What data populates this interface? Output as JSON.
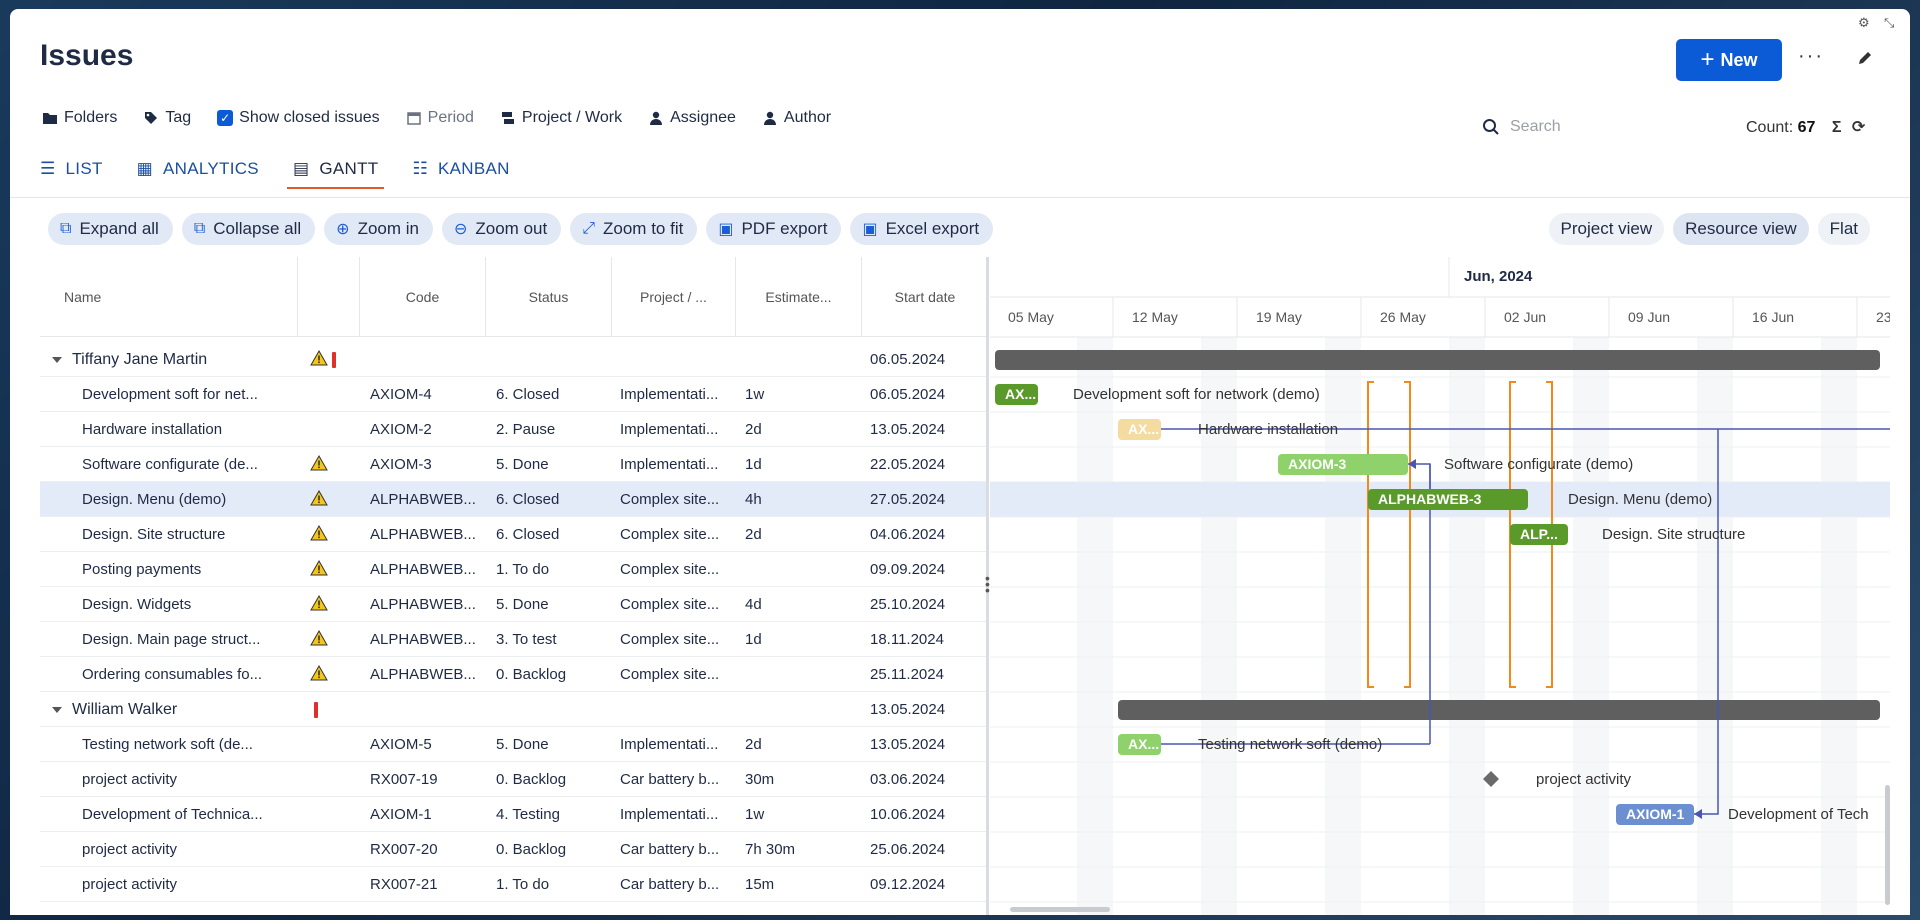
{
  "header": {
    "title": "Issues",
    "new_label": "New",
    "more_icon": "more-horizontal-icon",
    "edit_icon": "pencil-icon"
  },
  "filters": [
    {
      "label": "Folders",
      "icon": "folder-icon"
    },
    {
      "label": "Tag",
      "icon": "tag-icon"
    },
    {
      "label": "Show closed issues",
      "icon": "checkbox-checked-icon"
    },
    {
      "label": "Period",
      "icon": "calendar-icon"
    },
    {
      "label": "Project / Work",
      "icon": "project-icon"
    },
    {
      "label": "Assignee",
      "icon": "user-icon"
    },
    {
      "label": "Author",
      "icon": "user-icon"
    }
  ],
  "search": {
    "placeholder": "Search"
  },
  "count": {
    "label": "Count:",
    "value": "67"
  },
  "tabs": [
    {
      "label": "LIST"
    },
    {
      "label": "ANALYTICS"
    },
    {
      "label": "GANTT"
    },
    {
      "label": "KANBAN"
    }
  ],
  "toolbar": [
    "Expand all",
    "Collapse all",
    "Zoom in",
    "Zoom out",
    "Zoom to fit",
    "PDF export",
    "Excel export"
  ],
  "views": [
    "Project view",
    "Resource view",
    "Flat"
  ],
  "columns": [
    "Name",
    "",
    "Code",
    "Status",
    "Project / ...",
    "Estimate...",
    "Start date"
  ],
  "rows": [
    {
      "group": true,
      "name": "Tiffany Jane Martin",
      "warn": true,
      "excl": true,
      "code": "",
      "status": "",
      "project": "",
      "estimate": "",
      "start": "06.05.2024"
    },
    {
      "name": "Development soft for net...",
      "warn": false,
      "code": "AXIOM-4",
      "status": "6. Closed",
      "project": "Implementati...",
      "estimate": "1w",
      "start": "06.05.2024"
    },
    {
      "name": "Hardware installation",
      "warn": false,
      "code": "AXIOM-2",
      "status": "2. Pause",
      "project": "Implementati...",
      "estimate": "2d",
      "start": "13.05.2024"
    },
    {
      "name": "Software configurate (de...",
      "warn": true,
      "code": "AXIOM-3",
      "status": "5. Done",
      "project": "Implementati...",
      "estimate": "1d",
      "start": "22.05.2024"
    },
    {
      "name": "Design. Menu (demo)",
      "warn": true,
      "sel": true,
      "code": "ALPHABWEB...",
      "status": "6. Closed",
      "project": "Complex site...",
      "estimate": "4h",
      "start": "27.05.2024"
    },
    {
      "name": "Design. Site structure",
      "warn": true,
      "code": "ALPHABWEB...",
      "status": "6. Closed",
      "project": "Complex site...",
      "estimate": "2d",
      "start": "04.06.2024"
    },
    {
      "name": "Posting payments",
      "warn": true,
      "code": "ALPHABWEB...",
      "status": "1. To do",
      "project": "Complex site...",
      "estimate": "",
      "start": "09.09.2024"
    },
    {
      "name": "Design. Widgets",
      "warn": true,
      "code": "ALPHABWEB...",
      "status": "5. Done",
      "project": "Complex site...",
      "estimate": "4d",
      "start": "25.10.2024"
    },
    {
      "name": "Design. Main page struct...",
      "warn": true,
      "code": "ALPHABWEB...",
      "status": "3. To test",
      "project": "Complex site...",
      "estimate": "1d",
      "start": "18.11.2024"
    },
    {
      "name": "Ordering consumables fo...",
      "warn": true,
      "code": "ALPHABWEB...",
      "status": "0. Backlog",
      "project": "Complex site...",
      "estimate": "",
      "start": "25.11.2024"
    },
    {
      "group": true,
      "name": "William Walker",
      "warn": false,
      "excl": true,
      "code": "",
      "status": "",
      "project": "",
      "estimate": "",
      "start": "13.05.2024"
    },
    {
      "name": "Testing network soft (de...",
      "warn": false,
      "code": "AXIOM-5",
      "status": "5. Done",
      "project": "Implementati...",
      "estimate": "2d",
      "start": "13.05.2024"
    },
    {
      "name": "project activity",
      "warn": false,
      "code": "RX007-19",
      "status": "0. Backlog",
      "project": "Car battery b...",
      "estimate": "30m",
      "start": "03.06.2024"
    },
    {
      "name": "Development of Technica...",
      "warn": false,
      "code": "AXIOM-1",
      "status": "4. Testing",
      "project": "Implementati...",
      "estimate": "1w",
      "start": "10.06.2024"
    },
    {
      "name": "project activity",
      "warn": false,
      "code": "RX007-20",
      "status": "0. Backlog",
      "project": "Car battery b...",
      "estimate": "7h 30m",
      "start": "25.06.2024"
    },
    {
      "name": "project activity",
      "warn": false,
      "code": "RX007-21",
      "status": "1. To do",
      "project": "Car battery b...",
      "estimate": "15m",
      "start": "09.12.2024"
    }
  ],
  "gantt": {
    "month_label": "Jun, 2024",
    "weeks": [
      "05 May",
      "12 May",
      "19 May",
      "26 May",
      "02 Jun",
      "09 Jun",
      "16 Jun",
      "23"
    ],
    "bars": [
      {
        "row": 0,
        "type": "group"
      },
      {
        "row": 1,
        "label": "AX...",
        "caption": "Development soft for network (demo)",
        "color": "#5a9a2a"
      },
      {
        "row": 2,
        "label": "AX...",
        "caption": "Hardware installation",
        "color": "#f4dca0"
      },
      {
        "row": 3,
        "label": "AXIOM-3",
        "caption": "Software configurate (demo)",
        "color": "#8fd16a"
      },
      {
        "row": 4,
        "label": "ALPHABWEB-3",
        "caption": "Design. Menu (demo)",
        "color": "#5a9a2a"
      },
      {
        "row": 5,
        "label": "ALP...",
        "caption": "Design. Site structure",
        "color": "#5a9a2a"
      },
      {
        "row": 10,
        "type": "group"
      },
      {
        "row": 11,
        "label": "AX...",
        "caption": "Testing network soft (demo)",
        "color": "#8fd16a"
      },
      {
        "row": 12,
        "type": "milestone",
        "caption": "project activity"
      },
      {
        "row": 13,
        "label": "AXIOM-1",
        "caption": "Development of Tech",
        "color": "#6b8fd0"
      }
    ]
  }
}
